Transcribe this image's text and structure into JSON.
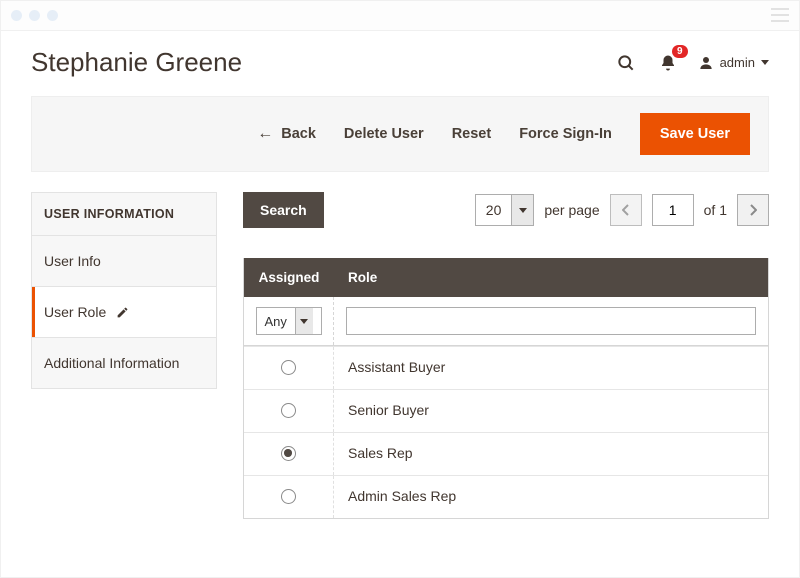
{
  "header": {
    "title": "Stephanie Greene",
    "notification_count": "9",
    "admin_label": "admin"
  },
  "actions": {
    "back": "Back",
    "delete": "Delete User",
    "reset": "Reset",
    "force_signin": "Force Sign-In",
    "save": "Save User"
  },
  "sidebar": {
    "heading": "USER INFORMATION",
    "items": [
      {
        "label": "User Info"
      },
      {
        "label": "User Role"
      },
      {
        "label": "Additional Information"
      }
    ]
  },
  "toolbar": {
    "search_label": "Search",
    "page_size": "20",
    "per_page_label": "per page",
    "current_page": "1",
    "total_pages_label": "of 1"
  },
  "grid": {
    "columns": {
      "assigned": "Assigned",
      "role": "Role"
    },
    "filter_assigned": "Any",
    "rows": [
      {
        "role": "Assistant Buyer",
        "assigned": false
      },
      {
        "role": "Senior Buyer",
        "assigned": false
      },
      {
        "role": "Sales Rep",
        "assigned": true
      },
      {
        "role": "Admin Sales Rep",
        "assigned": false
      }
    ]
  }
}
